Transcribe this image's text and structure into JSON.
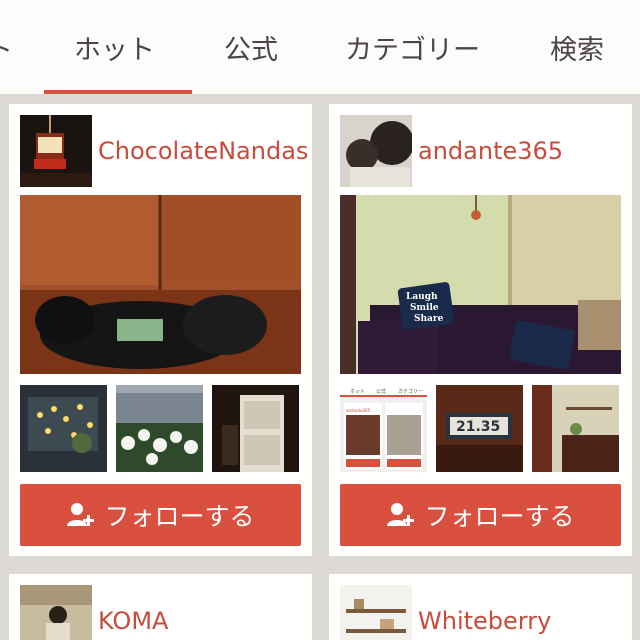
{
  "tabs": [
    {
      "label": "ト"
    },
    {
      "label": "ホット"
    },
    {
      "label": "公式"
    },
    {
      "label": "カテゴリー"
    },
    {
      "label": "検索"
    }
  ],
  "cards": [
    {
      "username": "ChocolateNandas",
      "follow_label": "フォローする"
    },
    {
      "username": "andante365",
      "follow_label": "フォローする"
    },
    {
      "username": "KOMA"
    },
    {
      "username": "Whiteberry"
    }
  ],
  "thumb_text": {
    "tabs": [
      "ホット",
      "公式",
      "カテゴリー"
    ],
    "plate": "21.35",
    "mini_user": "andante365",
    "pillow_lines": [
      "Laugh",
      "Smile",
      "Share"
    ]
  },
  "colors": {
    "accent": "#d9503f",
    "username": "#c84c3b",
    "background": "#ddd9d4"
  }
}
